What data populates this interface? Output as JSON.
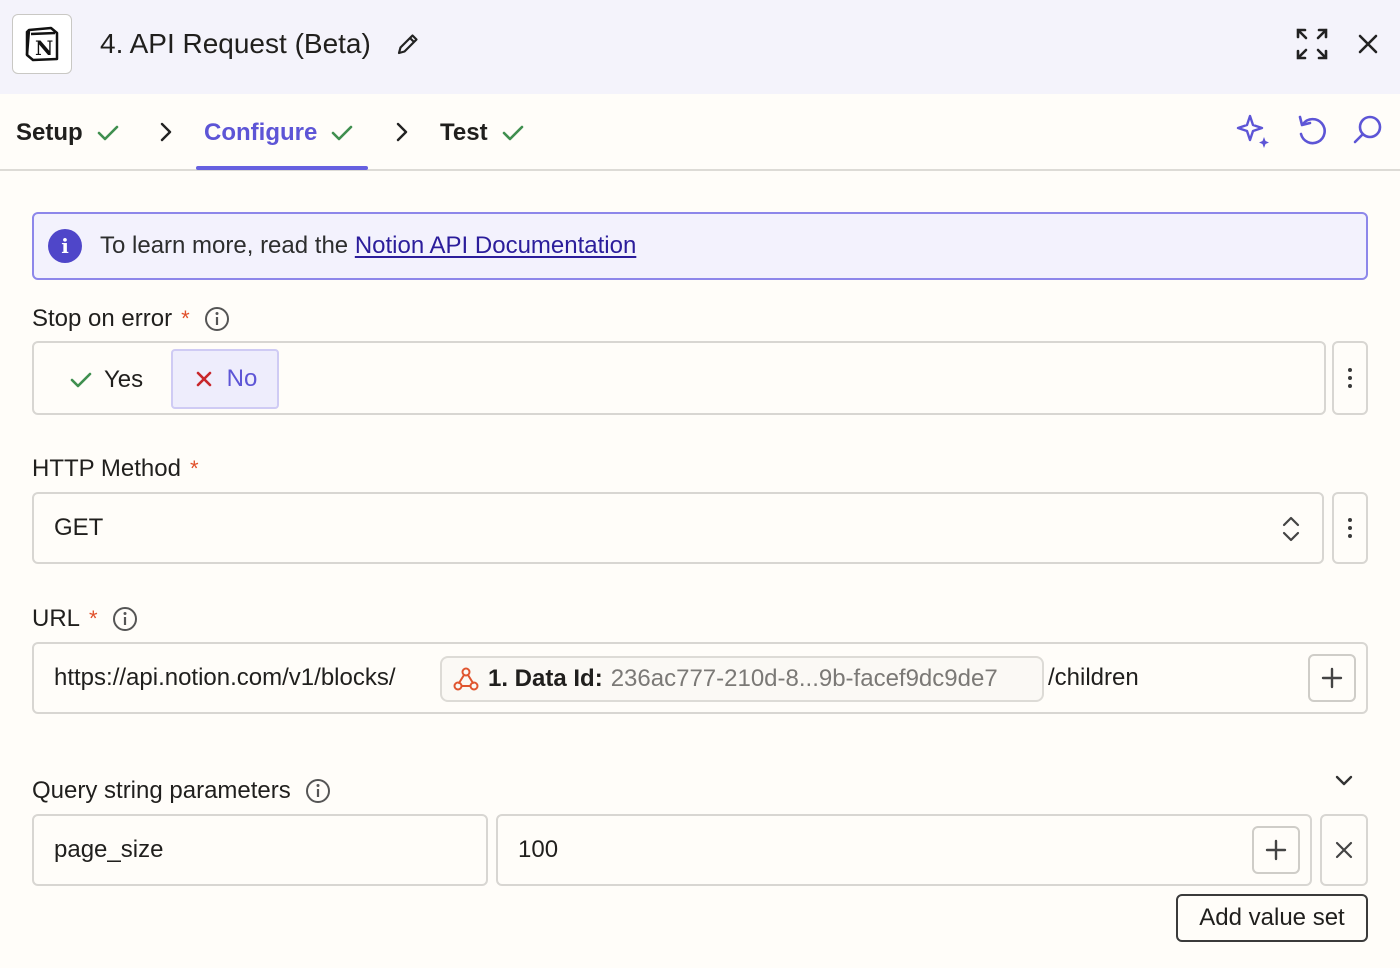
{
  "header": {
    "title": "4. API Request (Beta)",
    "app_logo_letter": "N"
  },
  "tabs": [
    {
      "label": "Setup",
      "complete": true
    },
    {
      "label": "Configure",
      "complete": true,
      "active": true
    },
    {
      "label": "Test",
      "complete": true
    }
  ],
  "banner": {
    "prefix": "To learn more, read the ",
    "link_text": "Notion API Documentation"
  },
  "stop_on_error": {
    "label": "Stop on error",
    "required_mark": "*",
    "yes_label": "Yes",
    "no_label": "No",
    "selected": "No"
  },
  "http_method": {
    "label": "HTTP Method",
    "required_mark": "*",
    "value": "GET"
  },
  "url": {
    "label": "URL",
    "required_mark": "*",
    "prefix": "https://api.notion.com/v1/blocks/",
    "pill_label": "1. Data Id:",
    "pill_value": "236ac777-210d-8...9b-facef9dc9de7",
    "suffix": "/children"
  },
  "query": {
    "label": "Query string parameters",
    "rows": [
      {
        "key": "page_size",
        "value": "100"
      }
    ],
    "add_button": "Add value set"
  },
  "colors": {
    "accent": "#5d55d6",
    "check": "#3f8f4f",
    "required": "#e1502b",
    "error_x": "#c8272b"
  }
}
